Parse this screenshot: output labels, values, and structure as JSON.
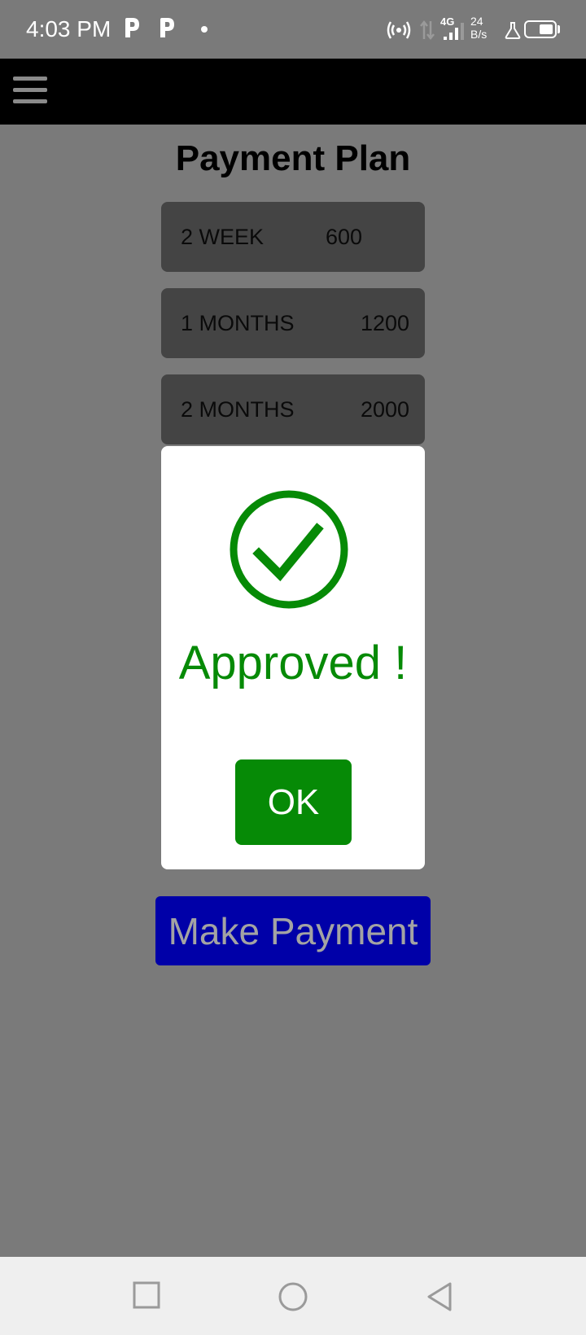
{
  "status_bar": {
    "time": "4:03 PM",
    "network_type": "4G",
    "speed_value": "24",
    "speed_unit": "B/s",
    "icons": [
      "p-app-icon",
      "p-app-icon",
      "dot-icon",
      "hotspot-icon",
      "data-arrows-icon",
      "signal-icon",
      "lab-flask-icon",
      "battery-icon"
    ]
  },
  "app_bar": {
    "menu_icon": "hamburger-menu-icon"
  },
  "page": {
    "title": "Payment Plan",
    "plans": [
      {
        "label": "2 WEEK",
        "price": "600"
      },
      {
        "label": "1 MONTHS",
        "price": "1200"
      },
      {
        "label": "2 MONTHS",
        "price": "2000"
      }
    ],
    "make_payment_label": "Make Payment"
  },
  "dialog": {
    "icon": "check-circle-icon",
    "message": "Approved !",
    "ok_label": "OK"
  },
  "nav_bar": {
    "icons": [
      "recents-square-icon",
      "home-circle-icon",
      "back-triangle-icon"
    ]
  },
  "colors": {
    "background": "#7a7a7a",
    "app_bar": "#000000",
    "plan_card": "#444444",
    "success_green": "#068a06",
    "payment_button": "#0000a8",
    "payment_text": "#a3a3a3",
    "nav_bar": "#efefef"
  }
}
